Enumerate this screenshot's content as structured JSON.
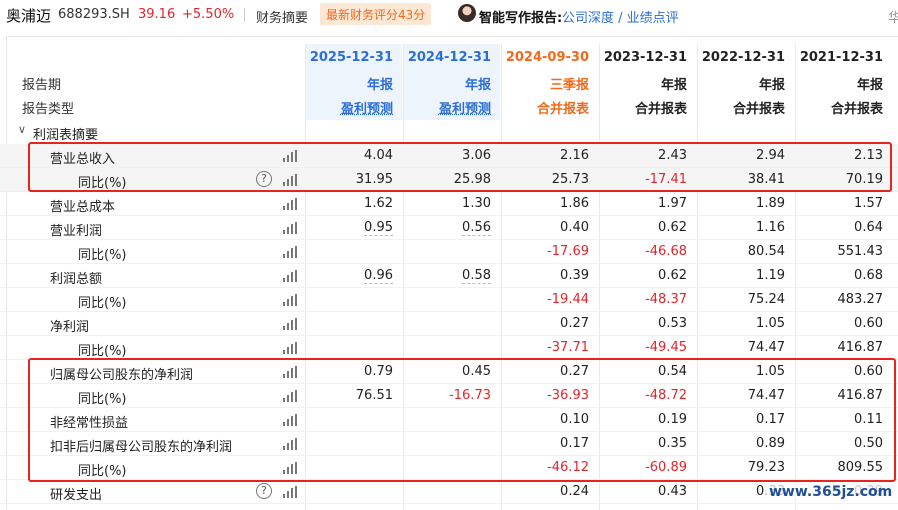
{
  "topbar": {
    "name": "奥浦迈",
    "code": "688293.SH",
    "price": "39.16",
    "change": "+5.50%",
    "fin_summary": "财务摘要",
    "score": "最新财务评分43分",
    "report_label": "智能写作报告:",
    "report_links": "公司深度 / 业绩点评",
    "cut_char": "华"
  },
  "header": {
    "period_label": "报告期",
    "type_label": "报告类型",
    "columns": [
      {
        "date": "2025-12-31",
        "kind": "年报",
        "type": "盈利预测"
      },
      {
        "date": "2024-12-31",
        "kind": "年报",
        "type": "盈利预测"
      },
      {
        "date": "2024-09-30",
        "kind": "三季报",
        "type": "合并报表"
      },
      {
        "date": "2023-12-31",
        "kind": "年报",
        "type": "合并报表"
      },
      {
        "date": "2022-12-31",
        "kind": "年报",
        "type": "合并报表"
      },
      {
        "date": "2021-12-31",
        "kind": "年报",
        "type": "合并报表"
      }
    ]
  },
  "section": {
    "label": "利润表摘要",
    "chevron": "∨"
  },
  "rows": [
    {
      "label": "营业总收入",
      "values": [
        "4.04",
        "3.06",
        "2.16",
        "2.43",
        "2.94",
        "2.13"
      ]
    },
    {
      "label": "同比(%)",
      "values": [
        "31.95",
        "25.98",
        "25.73",
        "-17.41",
        "38.41",
        "70.19"
      ]
    },
    {
      "label": "营业总成本",
      "values": [
        "1.62",
        "1.30",
        "1.86",
        "1.97",
        "1.89",
        "1.57"
      ]
    },
    {
      "label": "营业利润",
      "values": [
        "0.95",
        "0.56",
        "0.40",
        "0.62",
        "1.16",
        "0.64"
      ]
    },
    {
      "label": "同比(%)",
      "values": [
        "",
        "",
        "-17.69",
        "-46.68",
        "80.54",
        "551.43"
      ]
    },
    {
      "label": "利润总额",
      "values": [
        "0.96",
        "0.58",
        "0.39",
        "0.62",
        "1.19",
        "0.68"
      ]
    },
    {
      "label": "同比(%)",
      "values": [
        "",
        "",
        "-19.44",
        "-48.37",
        "75.24",
        "483.27"
      ]
    },
    {
      "label": "净利润",
      "values": [
        "",
        "",
        "0.27",
        "0.53",
        "1.05",
        "0.60"
      ]
    },
    {
      "label": "同比(%)",
      "values": [
        "",
        "",
        "-37.71",
        "-49.45",
        "74.47",
        "416.87"
      ]
    },
    {
      "label": "归属母公司股东的净利润",
      "values": [
        "0.79",
        "0.45",
        "0.27",
        "0.54",
        "1.05",
        "0.60"
      ]
    },
    {
      "label": "同比(%)",
      "values": [
        "76.51",
        "-16.73",
        "-36.93",
        "-48.72",
        "74.47",
        "416.87"
      ]
    },
    {
      "label": "非经常性损益",
      "values": [
        "",
        "",
        "0.10",
        "0.19",
        "0.17",
        "0.11"
      ]
    },
    {
      "label": "扣非后归属母公司股东的净利润",
      "values": [
        "",
        "",
        "0.17",
        "0.35",
        "0.89",
        "0.50"
      ]
    },
    {
      "label": "同比(%)",
      "values": [
        "",
        "",
        "-46.12",
        "-60.89",
        "79.23",
        "809.55"
      ]
    },
    {
      "label": "研发支出",
      "values": [
        "",
        "",
        "0.24",
        "0.43",
        "0.33",
        "0.29"
      ]
    }
  ],
  "help_glyph": "?",
  "watermark": "www.365jz.com",
  "colors": {
    "accent": "#2c6ed5",
    "negative": "#e0262b",
    "highlight_box": "#e8241f",
    "score_bg": "#fde8d6",
    "orange": "#f26a1b"
  }
}
